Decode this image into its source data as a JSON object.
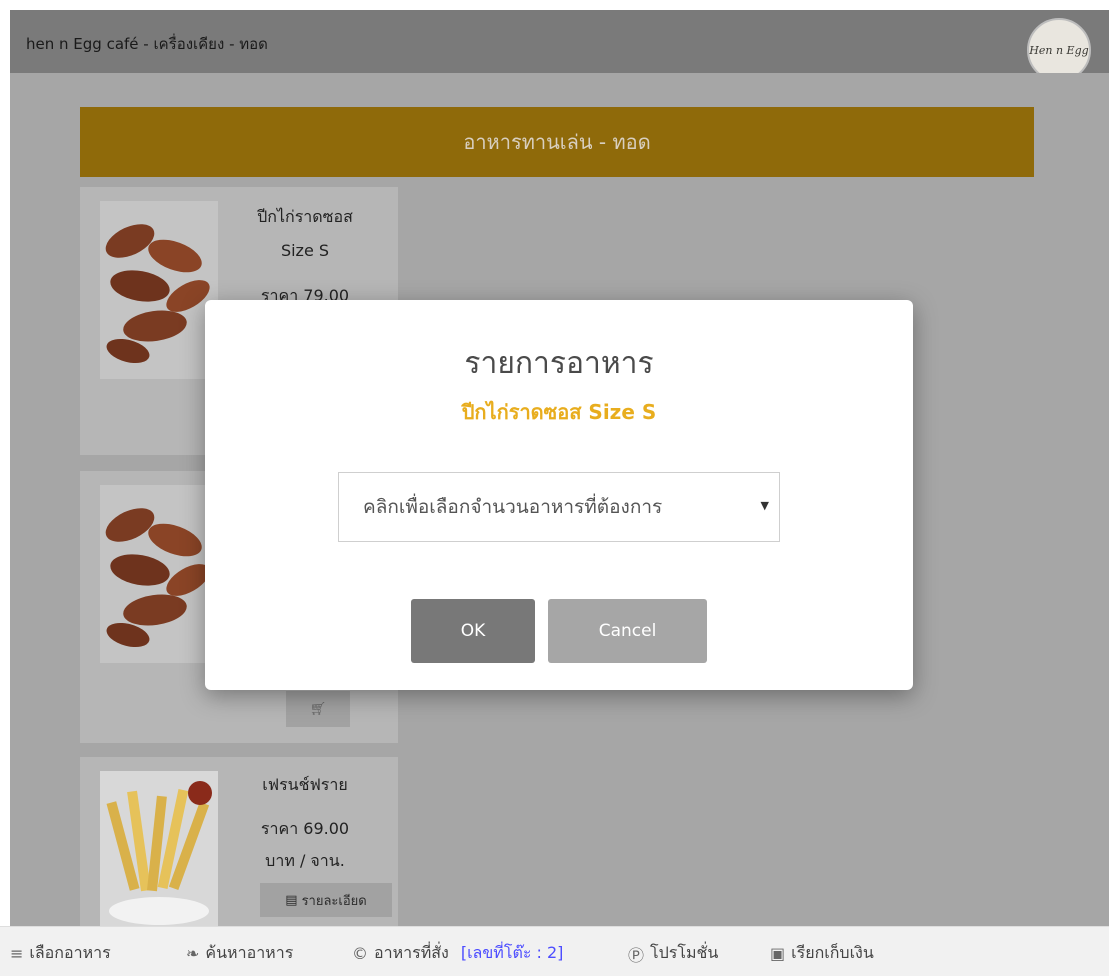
{
  "header": {
    "title": "hen n Egg café - เครื่องเคียง - ทอด",
    "logo_text": "Hen n Egg"
  },
  "category": {
    "title": "อาหารทานเล่น - ทอด"
  },
  "cards": [
    {
      "name_line1": "ปีกไก่ราดซอส",
      "name_line2": "Size S",
      "price_line1": "ราคา 79.00"
    },
    {
      "cart_icon": "cart-icon"
    },
    {
      "name_line1": "เฟรนช์ฟราย",
      "price_line1": "ราคา 69.00",
      "price_line2": "บาท / จาน.",
      "detail_label": "รายละเอียด"
    }
  ],
  "modal": {
    "title": "รายการอาหาร",
    "subtitle": "ปีกไก่ราดซอส Size S",
    "select_placeholder": "คลิกเพื่อเลือกจำนวนอาหารที่ต้องการ",
    "ok_label": "OK",
    "cancel_label": "Cancel"
  },
  "bottom_nav": {
    "items": [
      {
        "icon": "menu-icon",
        "label": "เลือกอาหาร"
      },
      {
        "icon": "leaf-icon",
        "label": "ค้นหาอาหาร"
      },
      {
        "icon": "copyright-icon",
        "label": "อาหารที่สั่ง",
        "extra": "[เลขที่โต๊ะ : 2]"
      },
      {
        "icon": "promo-icon",
        "label": "โปรโมชั่น"
      },
      {
        "icon": "money-icon",
        "label": "เรียกเก็บเงิน"
      }
    ]
  },
  "colors": {
    "header_bg": "#7a7a7a",
    "category_bg": "#8f6a0a",
    "accent_yellow": "#e8ad1e",
    "nav_extra": "#4d4dff"
  }
}
